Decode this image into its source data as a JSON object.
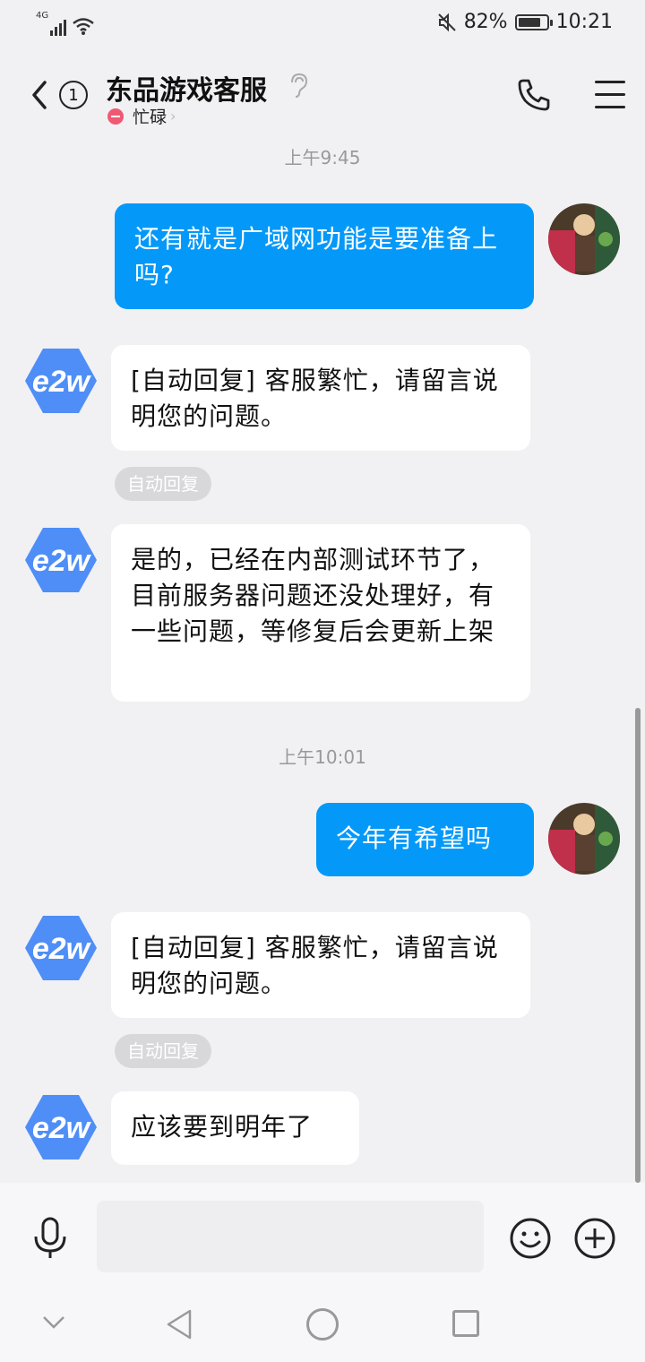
{
  "status_bar": {
    "network": "4G",
    "battery_percent": "82%",
    "battery_level": 0.82,
    "time": "10:21"
  },
  "header": {
    "unread_count": "1",
    "contact_name": "东品游戏客服",
    "status": "忙碌"
  },
  "messages": [
    {
      "id": "ts1",
      "type": "timestamp",
      "text": "上午9:45"
    },
    {
      "id": "m1",
      "type": "outgoing",
      "text": "还有就是广域网功能是要准备上吗?"
    },
    {
      "id": "m2",
      "type": "incoming",
      "text": "[自动回复] 客服繁忙，请留言说明您的问题。",
      "tag": "自动回复"
    },
    {
      "id": "m3",
      "type": "incoming",
      "text": "是的，已经在内部测试环节了，目前服务器问题还没处理好，有一些问题，等修复后会更新上架"
    },
    {
      "id": "ts2",
      "type": "timestamp",
      "text": "上午10:01"
    },
    {
      "id": "m4",
      "type": "outgoing",
      "text": "今年有希望吗"
    },
    {
      "id": "m5",
      "type": "incoming",
      "text": "[自动回复] 客服繁忙，请留言说明您的问题。",
      "tag": "自动回复"
    },
    {
      "id": "m6",
      "type": "incoming",
      "text": "应该要到明年了"
    }
  ],
  "agent_avatar_label": "e2w",
  "colors": {
    "outgoing_bubble": "#0499f9",
    "incoming_bubble": "#ffffff",
    "agent_avatar": "#4f8ef7",
    "busy_status": "#ef5a72"
  },
  "input": {
    "placeholder": ""
  },
  "icons": [
    "back-icon",
    "ear-icon",
    "phone-icon",
    "menu-icon",
    "mic-icon",
    "emoji-icon",
    "plus-icon"
  ]
}
